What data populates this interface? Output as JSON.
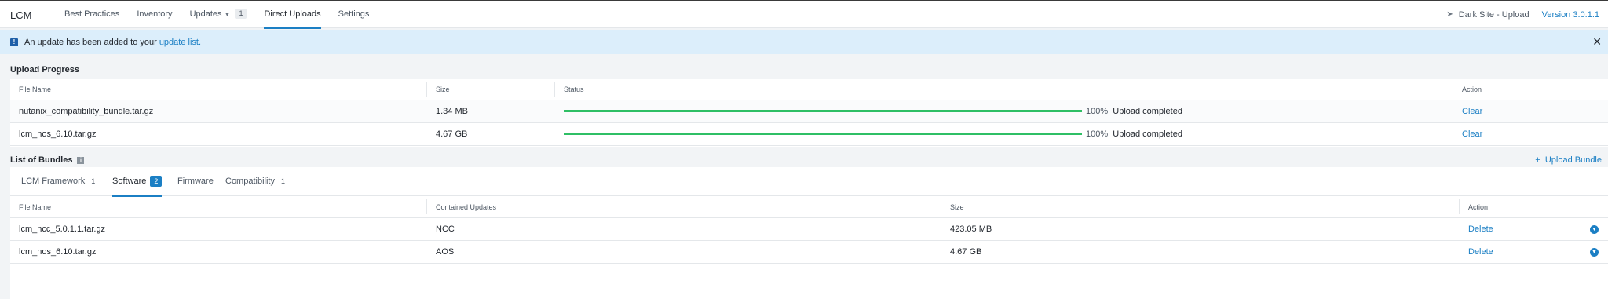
{
  "app": {
    "title": "LCM"
  },
  "nav": {
    "items": [
      {
        "label": "Best Practices"
      },
      {
        "label": "Inventory"
      },
      {
        "label": "Updates",
        "count": "1"
      },
      {
        "label": "Direct Uploads"
      },
      {
        "label": "Settings"
      }
    ],
    "active": "Direct Uploads"
  },
  "header": {
    "site_label": "Dark Site - Upload",
    "site_icon": "rocket-icon",
    "version_label": "Version 3.0.1.1"
  },
  "banner": {
    "text": "An update has been added to your",
    "link": "update list.",
    "icon": "info-icon",
    "close_icon": "close-icon"
  },
  "upload_progress": {
    "title": "Upload Progress",
    "columns": [
      "File Name",
      "Size",
      "Status",
      "Action"
    ],
    "rows": [
      {
        "file": "nutanix_compatibility_bundle.tar.gz",
        "size": "1.34 MB",
        "progress": 100,
        "percent": "100%",
        "status": "Upload completed",
        "action": "Clear"
      },
      {
        "file": "lcm_nos_6.10.tar.gz",
        "size": "4.67 GB",
        "progress": 100,
        "percent": "100%",
        "status": "Upload completed",
        "action": "Clear"
      }
    ]
  },
  "bundles": {
    "title": "List of Bundles",
    "upload_label": "Upload Bundle",
    "tabs": [
      {
        "label": "LCM Framework",
        "count": "1"
      },
      {
        "label": "Software",
        "count": "2"
      },
      {
        "label": "Firmware",
        "count": ""
      },
      {
        "label": "Compatibility",
        "count": "1"
      }
    ],
    "active_tab": "Software",
    "columns": [
      "File Name",
      "Contained Updates",
      "Size",
      "Action"
    ],
    "rows": [
      {
        "file": "lcm_ncc_5.0.1.1.tar.gz",
        "updates": "NCC",
        "size": "423.05 MB",
        "action": "Delete"
      },
      {
        "file": "lcm_nos_6.10.tar.gz",
        "updates": "AOS",
        "size": "4.67 GB",
        "action": "Delete"
      }
    ]
  },
  "colors": {
    "accent": "#1b7fc4",
    "progress": "#2fbf65",
    "banner_bg": "#dceefb"
  }
}
